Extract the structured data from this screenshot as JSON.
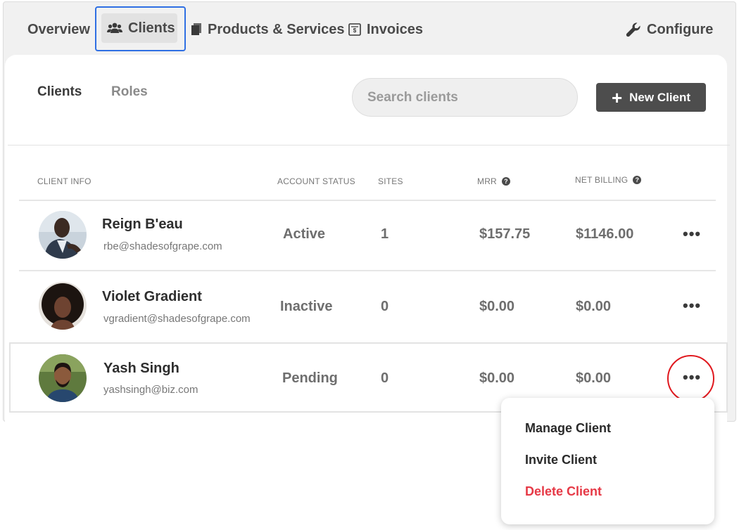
{
  "nav": {
    "overview": "Overview",
    "clients": "Clients",
    "products": "Products & Services",
    "invoices": "Invoices",
    "configure": "Configure"
  },
  "subtabs": {
    "clients": "Clients",
    "roles": "Roles"
  },
  "search": {
    "placeholder": "Search clients"
  },
  "new_client": {
    "label": "New Client"
  },
  "table": {
    "headers": {
      "client_info": "CLIENT INFO",
      "account_status": "ACCOUNT STATUS",
      "sites": "SITES",
      "mrr": "MRR",
      "net_billing": "NET BILLING"
    },
    "rows": [
      {
        "name": "Reign B'eau",
        "email": "rbe@shadesofgrape.com",
        "status": "Active",
        "sites": "1",
        "mrr": "$157.75",
        "net_billing": "$1146.00"
      },
      {
        "name": "Violet Gradient",
        "email": "vgradient@shadesofgrape.com",
        "status": "Inactive",
        "sites": "0",
        "mrr": "$0.00",
        "net_billing": "$0.00"
      },
      {
        "name": "Yash Singh",
        "email": "yashsingh@biz.com",
        "status": "Pending",
        "sites": "0",
        "mrr": "$0.00",
        "net_billing": "$0.00"
      }
    ]
  },
  "actions_label": "•••",
  "menu": {
    "manage": "Manage Client",
    "invite": "Invite Client",
    "delete": "Delete Client"
  },
  "colors": {
    "active_tab_outline": "#2f6fe3",
    "highlight_ring": "#e0181e",
    "danger": "#e63946",
    "button_bg": "#4d4d4d"
  },
  "icons": {
    "clients": "users-icon",
    "products": "document-icon",
    "invoices": "invoice-icon",
    "configure": "wrench-icon",
    "new_client": "plus-icon",
    "help": "question-icon",
    "actions": "more-horizontal-icon"
  }
}
